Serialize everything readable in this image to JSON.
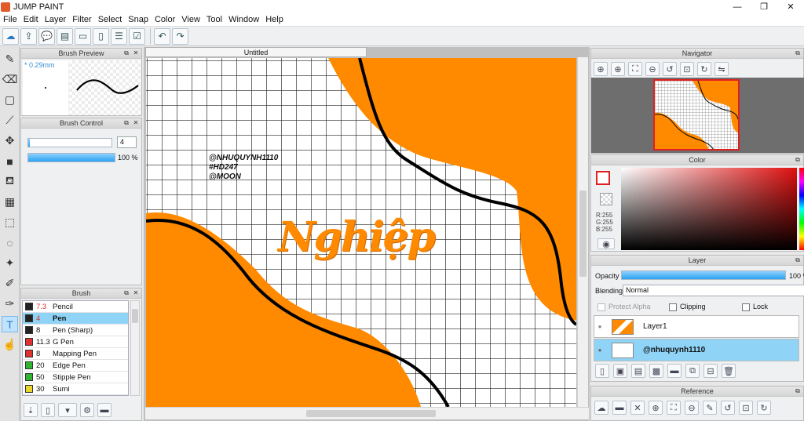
{
  "app": {
    "title": "JUMP PAINT"
  },
  "window_controls": {
    "minimize": "—",
    "maximize": "❐",
    "close": "✕"
  },
  "menu": [
    "File",
    "Edit",
    "Layer",
    "Filter",
    "Select",
    "Snap",
    "Color",
    "View",
    "Tool",
    "Window",
    "Help"
  ],
  "document": {
    "tab_title": "Untitled"
  },
  "brush_preview": {
    "title": "Brush Preview",
    "size_label": "* 0.29mm"
  },
  "brush_control": {
    "title": "Brush Control",
    "size_value": "4",
    "opacity_value": "100 %",
    "opacity": 100
  },
  "brush_panel": {
    "title": "Brush",
    "items": [
      {
        "size": "7.3",
        "name": "Pencil",
        "color": "#222222",
        "size_color": "#e03030"
      },
      {
        "size": "4",
        "name": "Pen",
        "color": "#222222",
        "size_color": "#e03030",
        "selected": true
      },
      {
        "size": "8",
        "name": "Pen (Sharp)",
        "color": "#222222",
        "size_color": "#111111"
      },
      {
        "size": "11.3",
        "name": "G Pen",
        "color": "#e03030",
        "size_color": "#111111"
      },
      {
        "size": "8",
        "name": "Mapping Pen",
        "color": "#e03030",
        "size_color": "#111111"
      },
      {
        "size": "20",
        "name": "Edge Pen",
        "color": "#2fb52f",
        "size_color": "#111111"
      },
      {
        "size": "50",
        "name": "Stipple Pen",
        "color": "#2fb52f",
        "size_color": "#111111"
      },
      {
        "size": "30",
        "name": "Sumi",
        "color": "#e8d62a",
        "size_color": "#111111"
      }
    ]
  },
  "canvas_text": {
    "credits": [
      "@NHUQUYNH1110",
      "#HD247",
      "@MOON"
    ],
    "title_art": "Nghiệp"
  },
  "navigator": {
    "title": "Navigator"
  },
  "color_panel": {
    "title": "Color",
    "r": "R:255",
    "g": "G:255",
    "b": "B:255"
  },
  "layer_panel": {
    "title": "Layer",
    "opacity_label": "Opacity",
    "opacity_value": "100 %",
    "opacity": 100,
    "blending_label": "Blending",
    "blending_value": "Normal",
    "protect_alpha": "Protect Alpha",
    "clipping": "Clipping",
    "lock": "Lock",
    "layers": [
      {
        "name": "Layer1",
        "selected": false
      },
      {
        "name": "@nhuquynh1110",
        "selected": true
      }
    ]
  },
  "reference": {
    "title": "Reference"
  },
  "colors": {
    "orange": "#ff8a00",
    "selection_blue": "#8fd4f7",
    "accent": "#2aa2ef"
  }
}
